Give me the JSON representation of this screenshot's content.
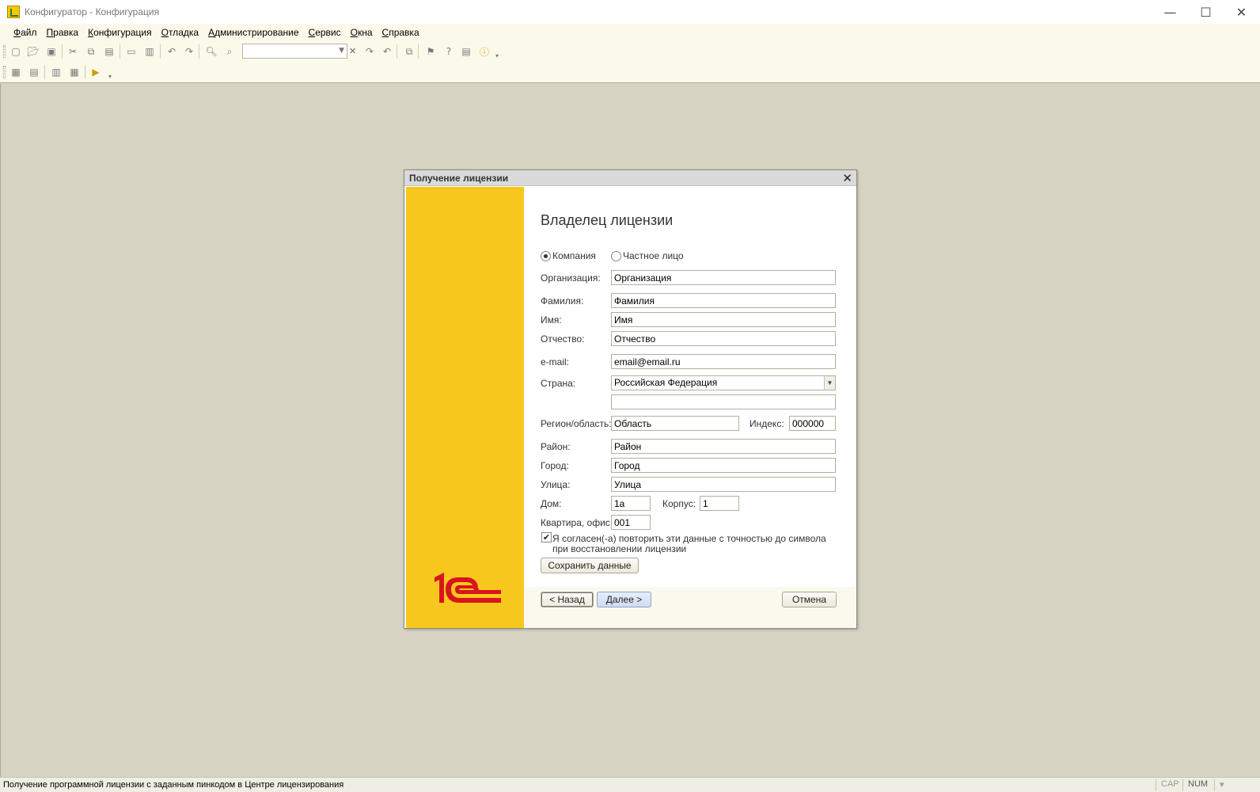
{
  "window": {
    "title": "Конфигуратор - Конфигурация",
    "controls": {
      "minimize": "—",
      "maximize": "☐",
      "close": "✕"
    }
  },
  "menu": {
    "items": [
      {
        "label": "Файл",
        "accel": "Ф",
        "rest": "айл"
      },
      {
        "label": "Правка",
        "accel": "П",
        "rest": "равка"
      },
      {
        "label": "Конфигурация",
        "accel": "К",
        "rest": "онфигурация"
      },
      {
        "label": "Отладка",
        "accel": "О",
        "rest": "тладка"
      },
      {
        "label": "Администрирование",
        "accel": "А",
        "rest": "дминистрирование"
      },
      {
        "label": "Сервис",
        "accel": "С",
        "rest": "ервис"
      },
      {
        "label": "Окна",
        "accel": "О",
        "rest": "кна"
      },
      {
        "label": "Справка",
        "accel": "С",
        "rest": "правка"
      }
    ]
  },
  "toolbar": {
    "search_value": "",
    "clear_glyph": "✕",
    "dropdown_glyph": "▼"
  },
  "dialog": {
    "title": "Получение лицензии",
    "close_glyph": "✕",
    "heading": "Владелец лицензии",
    "owner_type": {
      "company_label": "Компания",
      "private_label": "Частное лицо",
      "selected": "company"
    },
    "labels": {
      "organization": "Организация:",
      "last_name": "Фамилия:",
      "first_name": "Имя:",
      "patronymic": "Отчество:",
      "email": "e-mail:",
      "country": "Страна:",
      "region": "Регион/область:",
      "index": "Индекс:",
      "district": "Район:",
      "city": "Город:",
      "street": "Улица:",
      "house": "Дом:",
      "building": "Корпус:",
      "apartment": "Квартира, офис:"
    },
    "values": {
      "organization": "Организация",
      "last_name": "Фамилия",
      "first_name": "Имя",
      "patronymic": "Отчество",
      "email": "email@email.ru",
      "country": "Российская Федерация",
      "country_extra": "",
      "region": "Область",
      "index": "000000",
      "district": "Район",
      "city": "Город",
      "street": "Улица",
      "house": "1а",
      "building": "1",
      "apartment": "001"
    },
    "agree": {
      "checked": true,
      "line1": "Я согласен(-а) повторить эти данные с точностью до символа",
      "line2": "при восстановлении лицензии"
    },
    "buttons": {
      "save": "Сохранить данные",
      "back": "< Назад",
      "next": "Далее >",
      "cancel": "Отмена"
    },
    "brand": {
      "logo_text": "1С",
      "color": "#f8c71d",
      "logo_color": "#d8141c"
    }
  },
  "statusbar": {
    "text": "Получение программной лицензии с заданным пинкодом в Центре лицензирования",
    "cap": "CAP",
    "num": "NUM",
    "extra": "▾"
  }
}
